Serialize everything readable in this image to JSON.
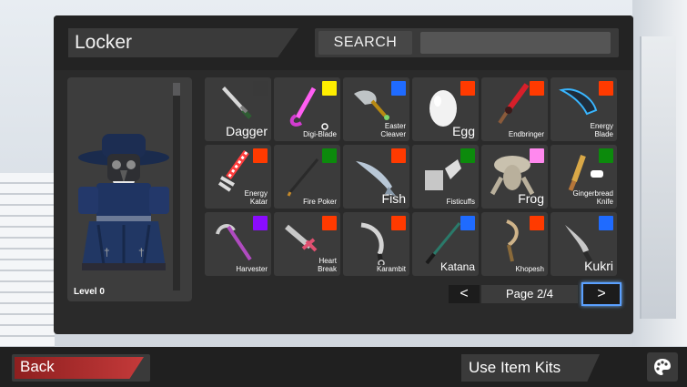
{
  "header": {
    "title": "Locker",
    "search_label": "SEARCH",
    "search_value": ""
  },
  "preview": {
    "level_label": "Level 0"
  },
  "items": [
    {
      "name": "Dagger",
      "rarity_color": "#3a3a3a",
      "icon": "dagger-icon",
      "size": "lg"
    },
    {
      "name": "Digi-Blade",
      "rarity_color": "#ffee00",
      "icon": "digi-blade-icon",
      "size": "sm"
    },
    {
      "name": "Easter Cleaver",
      "rarity_color": "#1f6bff",
      "icon": "easter-cleaver-icon",
      "size": "sm"
    },
    {
      "name": "Egg",
      "rarity_color": "#ff3a00",
      "icon": "egg-icon",
      "size": "lg"
    },
    {
      "name": "Endbringer",
      "rarity_color": "#ff3a00",
      "icon": "endbringer-icon",
      "size": "sm"
    },
    {
      "name": "Energy Blade",
      "rarity_color": "#ff3a00",
      "icon": "energy-blade-icon",
      "size": "sm"
    },
    {
      "name": "Energy Katar",
      "rarity_color": "#ff3a00",
      "icon": "energy-katar-icon",
      "size": "sm"
    },
    {
      "name": "Fire Poker",
      "rarity_color": "#0c8a0c",
      "icon": "fire-poker-icon",
      "size": "sm"
    },
    {
      "name": "Fish",
      "rarity_color": "#ff3a00",
      "icon": "fish-icon",
      "size": "lg"
    },
    {
      "name": "Fisticuffs",
      "rarity_color": "#0c8a0c",
      "icon": "fisticuffs-icon",
      "size": "sm"
    },
    {
      "name": "Frog",
      "rarity_color": "#ff88ee",
      "icon": "frog-icon",
      "size": "lg"
    },
    {
      "name": "Gingerbread Knife",
      "rarity_color": "#0c8a0c",
      "icon": "gingerbread-knife-icon",
      "size": "sm"
    },
    {
      "name": "Harvester",
      "rarity_color": "#8a0cff",
      "icon": "harvester-icon",
      "size": "sm"
    },
    {
      "name": "Heart Break",
      "rarity_color": "#ff3a00",
      "icon": "heart-break-icon",
      "size": "sm"
    },
    {
      "name": "Karambit",
      "rarity_color": "#ff3a00",
      "icon": "karambit-icon",
      "size": "sm"
    },
    {
      "name": "Katana",
      "rarity_color": "#1f6bff",
      "icon": "katana-icon",
      "size": "md"
    },
    {
      "name": "Khopesh",
      "rarity_color": "#ff3a00",
      "icon": "khopesh-icon",
      "size": "sm"
    },
    {
      "name": "Kukri",
      "rarity_color": "#1f6bff",
      "icon": "kukri-icon",
      "size": "lg"
    }
  ],
  "pager": {
    "prev": "<",
    "label": "Page 2/4",
    "next": ">"
  },
  "bottom": {
    "back_label": "Back",
    "kits_label": "Use Item Kits",
    "palette_icon": "palette-icon"
  }
}
